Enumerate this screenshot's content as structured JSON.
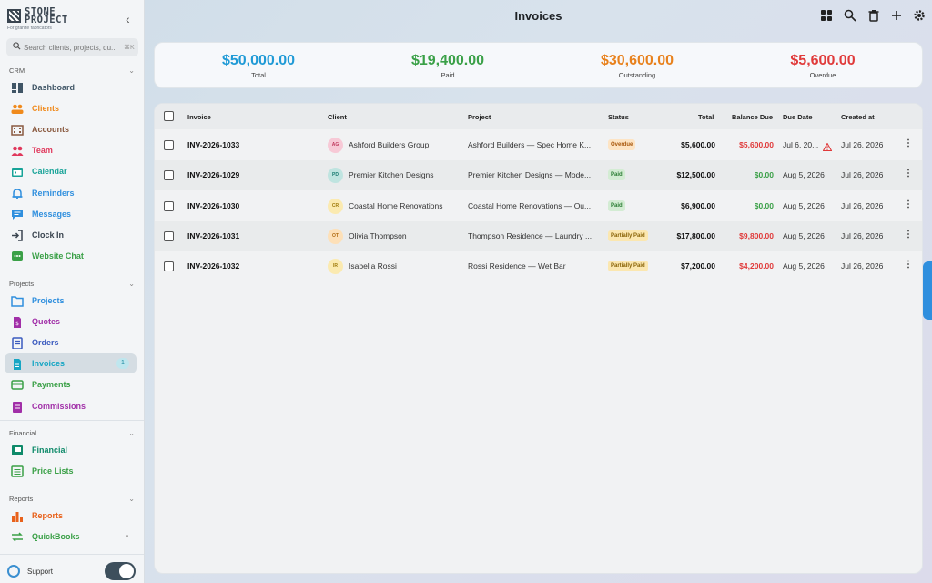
{
  "brand": {
    "name_line1": "STONE",
    "name_line2": "PROJECT",
    "tagline": "For granite fabricators"
  },
  "search": {
    "placeholder": "Search clients, projects, qu...",
    "shortcut": "⌘K"
  },
  "sections": {
    "crm": "CRM",
    "projects": "Projects",
    "financial": "Financial",
    "reports": "Reports"
  },
  "nav": {
    "crm": [
      {
        "label": "Dashboard",
        "color": "#3f5566",
        "icon": "dashboard-icon"
      },
      {
        "label": "Clients",
        "color": "#f08a1c",
        "icon": "people-icon"
      },
      {
        "label": "Accounts",
        "color": "#8a5a40",
        "icon": "building-icon"
      },
      {
        "label": "Team",
        "color": "#e0385c",
        "icon": "team-icon"
      },
      {
        "label": "Calendar",
        "color": "#17a398",
        "icon": "calendar-icon"
      },
      {
        "label": "Reminders",
        "color": "#2f8fde",
        "icon": "bell-icon"
      },
      {
        "label": "Messages",
        "color": "#2f8fde",
        "icon": "chat-icon"
      },
      {
        "label": "Clock In",
        "color": "#3a4550",
        "icon": "login-icon"
      },
      {
        "label": "Website Chat",
        "color": "#3aa047",
        "icon": "website-chat-icon"
      }
    ],
    "projects": [
      {
        "label": "Projects",
        "color": "#2f8fde",
        "icon": "folder-icon"
      },
      {
        "label": "Quotes",
        "color": "#a12fa8",
        "icon": "quote-icon"
      },
      {
        "label": "Orders",
        "color": "#3b5bbf",
        "icon": "orders-icon"
      },
      {
        "label": "Invoices",
        "color": "#17a6c4",
        "icon": "invoice-icon",
        "badge": "1"
      },
      {
        "label": "Payments",
        "color": "#3aa047",
        "icon": "card-icon"
      },
      {
        "label": "Commissions",
        "color": "#a12fa8",
        "icon": "commission-icon"
      }
    ],
    "financial": [
      {
        "label": "Financial",
        "color": "#0f8a6a",
        "icon": "ledger-icon"
      },
      {
        "label": "Price Lists",
        "color": "#3aa047",
        "icon": "list-icon"
      }
    ],
    "reports": [
      {
        "label": "Reports",
        "color": "#e8621c",
        "icon": "bar-chart-icon"
      },
      {
        "label": "QuickBooks",
        "color": "#3aa047",
        "icon": "sync-icon"
      }
    ]
  },
  "support": {
    "label": "Support",
    "enabled": true
  },
  "header": {
    "title": "Invoices"
  },
  "summary": [
    {
      "amount": "$50,000.00",
      "caption": "Total",
      "color": "#1f9ad6"
    },
    {
      "amount": "$19,400.00",
      "caption": "Paid",
      "color": "#3aa047"
    },
    {
      "amount": "$30,600.00",
      "caption": "Outstanding",
      "color": "#e8811c"
    },
    {
      "amount": "$5,600.00",
      "caption": "Overdue",
      "color": "#e03a3a"
    }
  ],
  "table": {
    "columns": [
      "Invoice",
      "Client",
      "Project",
      "Status",
      "Total",
      "Balance Due",
      "Due Date",
      "Created at"
    ],
    "rows": [
      {
        "invoice": "INV-2026-1033",
        "initials": "AG",
        "avatar_bg": "#f7c9d6",
        "avatar_fg": "#c0395e",
        "client": "Ashford Builders Group",
        "project": "Ashford Builders — Spec Home K...",
        "status": "Overdue",
        "status_bg": "#fde4c4",
        "status_fg": "#a8580d",
        "total": "$5,600.00",
        "balance": "$5,600.00",
        "balance_color": "#e03a3a",
        "due": "Jul 6, 20...",
        "overdue_warning": true,
        "created": "Jul 26, 2026"
      },
      {
        "invoice": "INV-2026-1029",
        "initials": "PD",
        "avatar_bg": "#bfe4e0",
        "avatar_fg": "#167a70",
        "client": "Premier Kitchen Designs",
        "project": "Premier Kitchen Designs — Mode...",
        "status": "Paid",
        "status_bg": "#d3ecd3",
        "status_fg": "#2a7d33",
        "total": "$12,500.00",
        "balance": "$0.00",
        "balance_color": "#3aa047",
        "due": "Aug 5, 2026",
        "overdue_warning": false,
        "created": "Jul 26, 2026"
      },
      {
        "invoice": "INV-2026-1030",
        "initials": "CR",
        "avatar_bg": "#fbeab0",
        "avatar_fg": "#a07b0c",
        "client": "Coastal Home Renovations",
        "project": "Coastal Home Renovations — Ou...",
        "status": "Paid",
        "status_bg": "#d3ecd3",
        "status_fg": "#2a7d33",
        "total": "$6,900.00",
        "balance": "$0.00",
        "balance_color": "#3aa047",
        "due": "Aug 5, 2026",
        "overdue_warning": false,
        "created": "Jul 26, 2026"
      },
      {
        "invoice": "INV-2026-1031",
        "initials": "OT",
        "avatar_bg": "#fde0b8",
        "avatar_fg": "#b06a10",
        "client": "Olivia Thompson",
        "project": "Thompson Residence — Laundry ...",
        "status": "Partially Paid",
        "status_bg": "#fbe7b0",
        "status_fg": "#8a6408",
        "total": "$17,800.00",
        "balance": "$9,800.00",
        "balance_color": "#e03a3a",
        "due": "Aug 5, 2026",
        "overdue_warning": false,
        "created": "Jul 26, 2026"
      },
      {
        "invoice": "INV-2026-1032",
        "initials": "IR",
        "avatar_bg": "#fbeab0",
        "avatar_fg": "#a07b0c",
        "client": "Isabella Rossi",
        "project": "Rossi Residence — Wet Bar",
        "status": "Partially Paid",
        "status_bg": "#fbe7b0",
        "status_fg": "#8a6408",
        "total": "$7,200.00",
        "balance": "$4,200.00",
        "balance_color": "#e03a3a",
        "due": "Aug 5, 2026",
        "overdue_warning": false,
        "created": "Jul 26, 2026"
      }
    ]
  }
}
